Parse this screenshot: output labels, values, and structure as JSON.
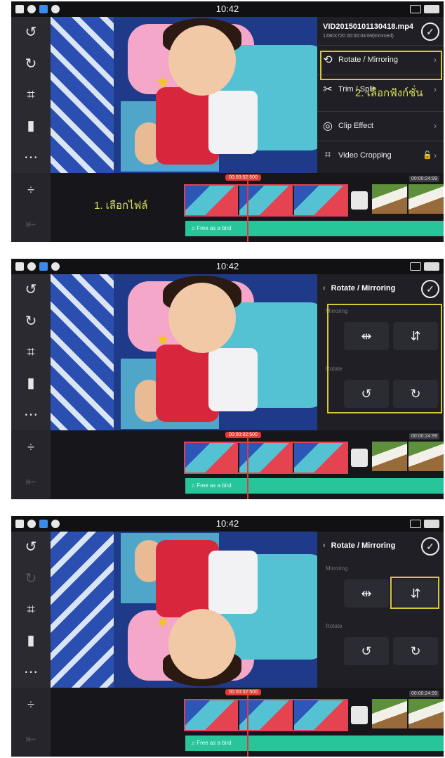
{
  "status": {
    "time": "10:42"
  },
  "screens": [
    {
      "file": {
        "name": "VID20150101130418.mp4",
        "meta": "1280X720 00:00:04:69(trimmed)"
      },
      "menu": [
        {
          "icon": "⟲",
          "label": "Rotate / Mirroring"
        },
        {
          "icon": "✂",
          "label": "Trim / Split"
        },
        {
          "icon": "◎",
          "label": "Clip Effect"
        },
        {
          "icon": "⌗",
          "label": "Video Cropping"
        }
      ],
      "annotation_select_file": "1. เลือกไฟล์",
      "annotation_select_function": "2. เลือกฟังก์ชั่น"
    },
    {
      "panel_title": "Rotate / Mirroring",
      "mirroring_label": "Mirroring",
      "rotate_label": "Rotate"
    },
    {
      "panel_title": "Rotate / Mirroring",
      "mirroring_label": "Mirroring",
      "rotate_label": "Rotate"
    }
  ],
  "timeline": {
    "tag": "00:00:02:500",
    "duration_1": "00:00:24:99",
    "duration_2": "00:00:24:99",
    "duration_3": "00:00:24:99",
    "audio_label": "Free as a bird"
  },
  "colors": {
    "highlight": "#d7c63a",
    "audio": "#27c59a",
    "playhead": "#e03a3a"
  },
  "icons": {
    "tools": [
      "undo-icon",
      "redo-icon",
      "fullscreen-icon",
      "delete-icon",
      "more-icon"
    ],
    "mirror": [
      "mirror-horizontal-icon",
      "mirror-vertical-icon"
    ],
    "rotate": [
      "rotate-left-icon",
      "rotate-right-icon"
    ]
  }
}
